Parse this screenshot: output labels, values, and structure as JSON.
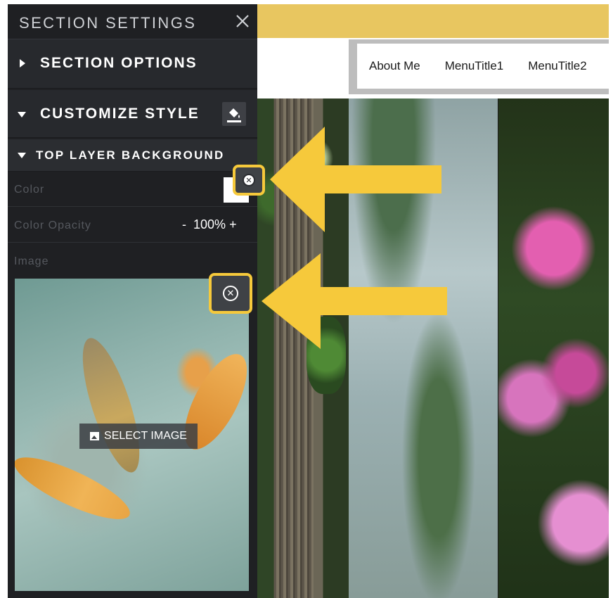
{
  "panel": {
    "title": "SECTION SETTINGS",
    "close_icon": "close-icon"
  },
  "sections": {
    "options_label": "SECTION OPTIONS",
    "customize_label": "CUSTOMIZE STYLE",
    "customize_icon": "paint-bucket-icon",
    "top_layer_label": "TOP LAYER BACKGROUND"
  },
  "fields": {
    "color_label": "Color",
    "color_value": "#ffffff",
    "opacity_label": "Color Opacity",
    "opacity_minus": "-",
    "opacity_value": "100%",
    "opacity_plus": "+",
    "image_label": "Image",
    "select_image_label": "SELECT IMAGE",
    "select_image_icon": "image-icon"
  },
  "nav": {
    "items": [
      "About Me",
      "MenuTitle1",
      "MenuTitle2"
    ]
  },
  "colors": {
    "panel_bg": "#1f2023",
    "highlight": "#f6c93b",
    "header_band": "#e8c660"
  }
}
